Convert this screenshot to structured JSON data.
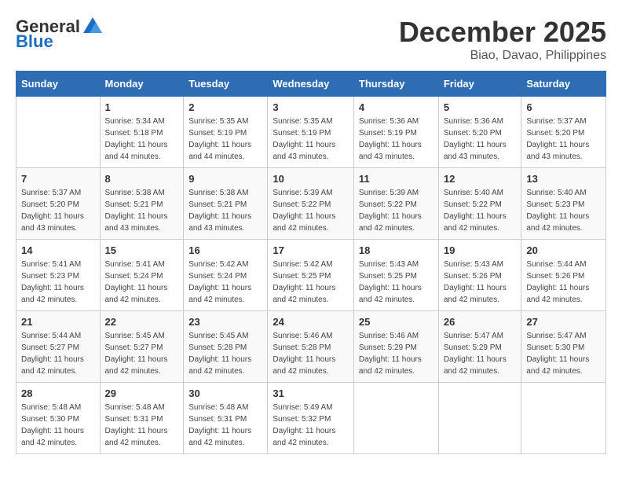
{
  "logo": {
    "general": "General",
    "blue": "Blue"
  },
  "title": "December 2025",
  "location": "Biao, Davao, Philippines",
  "weekdays": [
    "Sunday",
    "Monday",
    "Tuesday",
    "Wednesday",
    "Thursday",
    "Friday",
    "Saturday"
  ],
  "weeks": [
    [
      {
        "day": "",
        "sunrise": "",
        "sunset": "",
        "daylight": ""
      },
      {
        "day": "1",
        "sunrise": "Sunrise: 5:34 AM",
        "sunset": "Sunset: 5:18 PM",
        "daylight": "Daylight: 11 hours and 44 minutes."
      },
      {
        "day": "2",
        "sunrise": "Sunrise: 5:35 AM",
        "sunset": "Sunset: 5:19 PM",
        "daylight": "Daylight: 11 hours and 44 minutes."
      },
      {
        "day": "3",
        "sunrise": "Sunrise: 5:35 AM",
        "sunset": "Sunset: 5:19 PM",
        "daylight": "Daylight: 11 hours and 43 minutes."
      },
      {
        "day": "4",
        "sunrise": "Sunrise: 5:36 AM",
        "sunset": "Sunset: 5:19 PM",
        "daylight": "Daylight: 11 hours and 43 minutes."
      },
      {
        "day": "5",
        "sunrise": "Sunrise: 5:36 AM",
        "sunset": "Sunset: 5:20 PM",
        "daylight": "Daylight: 11 hours and 43 minutes."
      },
      {
        "day": "6",
        "sunrise": "Sunrise: 5:37 AM",
        "sunset": "Sunset: 5:20 PM",
        "daylight": "Daylight: 11 hours and 43 minutes."
      }
    ],
    [
      {
        "day": "7",
        "sunrise": "Sunrise: 5:37 AM",
        "sunset": "Sunset: 5:20 PM",
        "daylight": "Daylight: 11 hours and 43 minutes."
      },
      {
        "day": "8",
        "sunrise": "Sunrise: 5:38 AM",
        "sunset": "Sunset: 5:21 PM",
        "daylight": "Daylight: 11 hours and 43 minutes."
      },
      {
        "day": "9",
        "sunrise": "Sunrise: 5:38 AM",
        "sunset": "Sunset: 5:21 PM",
        "daylight": "Daylight: 11 hours and 43 minutes."
      },
      {
        "day": "10",
        "sunrise": "Sunrise: 5:39 AM",
        "sunset": "Sunset: 5:22 PM",
        "daylight": "Daylight: 11 hours and 42 minutes."
      },
      {
        "day": "11",
        "sunrise": "Sunrise: 5:39 AM",
        "sunset": "Sunset: 5:22 PM",
        "daylight": "Daylight: 11 hours and 42 minutes."
      },
      {
        "day": "12",
        "sunrise": "Sunrise: 5:40 AM",
        "sunset": "Sunset: 5:22 PM",
        "daylight": "Daylight: 11 hours and 42 minutes."
      },
      {
        "day": "13",
        "sunrise": "Sunrise: 5:40 AM",
        "sunset": "Sunset: 5:23 PM",
        "daylight": "Daylight: 11 hours and 42 minutes."
      }
    ],
    [
      {
        "day": "14",
        "sunrise": "Sunrise: 5:41 AM",
        "sunset": "Sunset: 5:23 PM",
        "daylight": "Daylight: 11 hours and 42 minutes."
      },
      {
        "day": "15",
        "sunrise": "Sunrise: 5:41 AM",
        "sunset": "Sunset: 5:24 PM",
        "daylight": "Daylight: 11 hours and 42 minutes."
      },
      {
        "day": "16",
        "sunrise": "Sunrise: 5:42 AM",
        "sunset": "Sunset: 5:24 PM",
        "daylight": "Daylight: 11 hours and 42 minutes."
      },
      {
        "day": "17",
        "sunrise": "Sunrise: 5:42 AM",
        "sunset": "Sunset: 5:25 PM",
        "daylight": "Daylight: 11 hours and 42 minutes."
      },
      {
        "day": "18",
        "sunrise": "Sunrise: 5:43 AM",
        "sunset": "Sunset: 5:25 PM",
        "daylight": "Daylight: 11 hours and 42 minutes."
      },
      {
        "day": "19",
        "sunrise": "Sunrise: 5:43 AM",
        "sunset": "Sunset: 5:26 PM",
        "daylight": "Daylight: 11 hours and 42 minutes."
      },
      {
        "day": "20",
        "sunrise": "Sunrise: 5:44 AM",
        "sunset": "Sunset: 5:26 PM",
        "daylight": "Daylight: 11 hours and 42 minutes."
      }
    ],
    [
      {
        "day": "21",
        "sunrise": "Sunrise: 5:44 AM",
        "sunset": "Sunset: 5:27 PM",
        "daylight": "Daylight: 11 hours and 42 minutes."
      },
      {
        "day": "22",
        "sunrise": "Sunrise: 5:45 AM",
        "sunset": "Sunset: 5:27 PM",
        "daylight": "Daylight: 11 hours and 42 minutes."
      },
      {
        "day": "23",
        "sunrise": "Sunrise: 5:45 AM",
        "sunset": "Sunset: 5:28 PM",
        "daylight": "Daylight: 11 hours and 42 minutes."
      },
      {
        "day": "24",
        "sunrise": "Sunrise: 5:46 AM",
        "sunset": "Sunset: 5:28 PM",
        "daylight": "Daylight: 11 hours and 42 minutes."
      },
      {
        "day": "25",
        "sunrise": "Sunrise: 5:46 AM",
        "sunset": "Sunset: 5:29 PM",
        "daylight": "Daylight: 11 hours and 42 minutes."
      },
      {
        "day": "26",
        "sunrise": "Sunrise: 5:47 AM",
        "sunset": "Sunset: 5:29 PM",
        "daylight": "Daylight: 11 hours and 42 minutes."
      },
      {
        "day": "27",
        "sunrise": "Sunrise: 5:47 AM",
        "sunset": "Sunset: 5:30 PM",
        "daylight": "Daylight: 11 hours and 42 minutes."
      }
    ],
    [
      {
        "day": "28",
        "sunrise": "Sunrise: 5:48 AM",
        "sunset": "Sunset: 5:30 PM",
        "daylight": "Daylight: 11 hours and 42 minutes."
      },
      {
        "day": "29",
        "sunrise": "Sunrise: 5:48 AM",
        "sunset": "Sunset: 5:31 PM",
        "daylight": "Daylight: 11 hours and 42 minutes."
      },
      {
        "day": "30",
        "sunrise": "Sunrise: 5:48 AM",
        "sunset": "Sunset: 5:31 PM",
        "daylight": "Daylight: 11 hours and 42 minutes."
      },
      {
        "day": "31",
        "sunrise": "Sunrise: 5:49 AM",
        "sunset": "Sunset: 5:32 PM",
        "daylight": "Daylight: 11 hours and 42 minutes."
      },
      {
        "day": "",
        "sunrise": "",
        "sunset": "",
        "daylight": ""
      },
      {
        "day": "",
        "sunrise": "",
        "sunset": "",
        "daylight": ""
      },
      {
        "day": "",
        "sunrise": "",
        "sunset": "",
        "daylight": ""
      }
    ]
  ]
}
